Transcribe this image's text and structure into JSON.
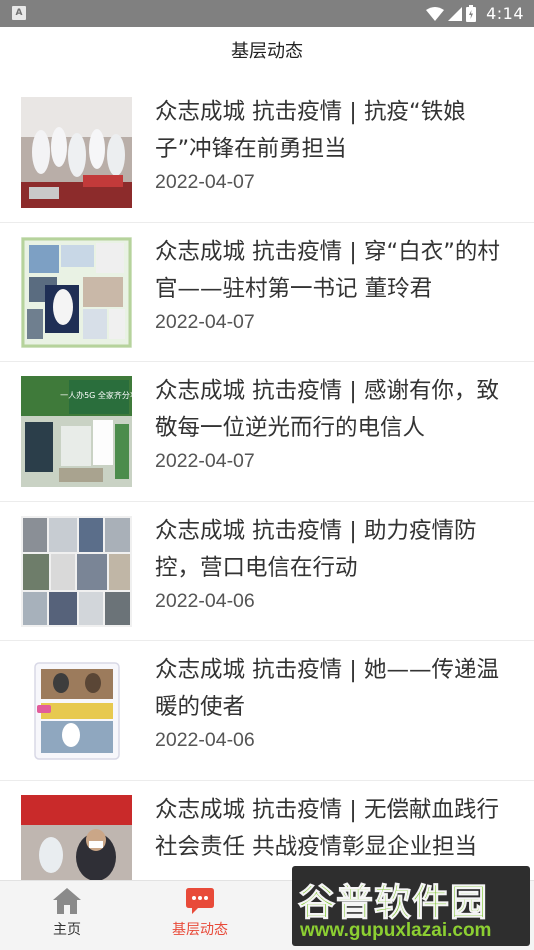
{
  "status_bar": {
    "sim_label": "A",
    "time": "4:14",
    "icons": [
      "wifi-icon",
      "signal-icon",
      "battery-icon"
    ]
  },
  "header": {
    "title": "基层动态"
  },
  "news": [
    {
      "title": "众志成城 抗击疫情 | 抗疫“铁娘子”冲锋在前勇担当",
      "date": "2022-04-07"
    },
    {
      "title": "众志成城 抗击疫情 | 穿“白衣”的村官——驻村第一书记 董玲君",
      "date": "2022-04-07"
    },
    {
      "title": "众志成城 抗击疫情 | 感谢有你，致敬每一位逆光而行的电信人",
      "date": "2022-04-07"
    },
    {
      "title": "众志成城 抗击疫情 | 助力疫情防控，营口电信在行动",
      "date": "2022-04-06"
    },
    {
      "title": "众志成城 抗击疫情 | 她——传递温暖的使者",
      "date": "2022-04-06"
    },
    {
      "title": "众志成城 抗击疫情 | 无偿献血践行社会责任 共战疫情彰显企业担当",
      "date": ""
    }
  ],
  "thumb_texts": {
    "banner_text": "一人办5G 全家齐分享"
  },
  "tabbar": {
    "home_label": "主页",
    "dongtai_label": "基层动态",
    "active_color": "#e84a39",
    "inactive_color": "#333333"
  },
  "watermark": {
    "main": "谷普软件园",
    "url": "www.gupuxlazai.com"
  }
}
